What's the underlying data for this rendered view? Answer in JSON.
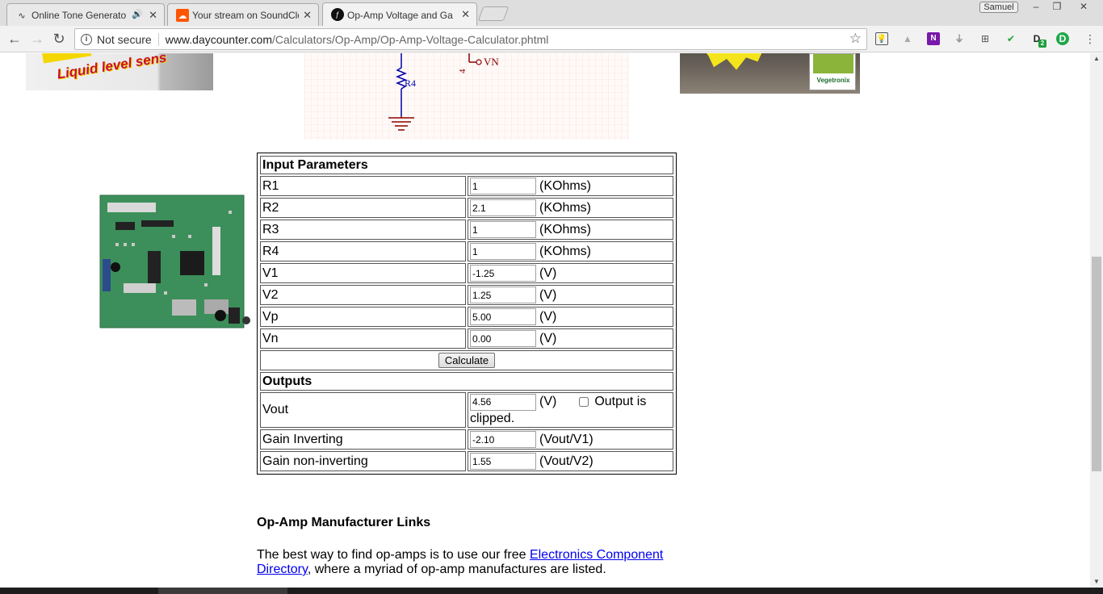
{
  "browser": {
    "tabs": [
      {
        "title": "Online Tone Generato",
        "audio": true,
        "favicon": "wave-icon",
        "active": false
      },
      {
        "title": "Your stream on SoundClo",
        "audio": false,
        "favicon": "soundcloud-icon",
        "active": false
      },
      {
        "title": "Op-Amp Voltage and Ga",
        "audio": false,
        "favicon": "daycounter-icon",
        "active": true
      }
    ],
    "profile_name": "Samuel",
    "security_label": "Not secure",
    "url_host": "www.daycounter.com",
    "url_path": "/Calculators/Op-Amp/Op-Amp-Voltage-Calculator.phtml",
    "extension_badge": "2"
  },
  "schematic": {
    "resistor_label": "R4",
    "node_label": "VN",
    "pin_label": "4"
  },
  "ads": {
    "left_text": "Liquid level sens",
    "right_logo": "Vegetronix"
  },
  "calculator": {
    "input_header": "Input Parameters",
    "inputs": [
      {
        "label": "R1",
        "value": "1",
        "unit": "(KOhms)"
      },
      {
        "label": "R2",
        "value": "2.1",
        "unit": "(KOhms)"
      },
      {
        "label": "R3",
        "value": "1",
        "unit": "(KOhms)"
      },
      {
        "label": "R4",
        "value": "1",
        "unit": "(KOhms)"
      },
      {
        "label": "V1",
        "value": "-1.25",
        "unit": "(V)"
      },
      {
        "label": "V2",
        "value": "1.25",
        "unit": "(V)"
      },
      {
        "label": "Vp",
        "value": "5.00",
        "unit": "(V)"
      },
      {
        "label": "Vn",
        "value": "0.00",
        "unit": "(V)"
      }
    ],
    "calculate_label": "Calculate",
    "output_header": "Outputs",
    "vout": {
      "label": "Vout",
      "value": "4.56",
      "unit": "(V)",
      "clipped_label": "Output is clipped.",
      "clipped": false
    },
    "gain_inverting": {
      "label": "Gain Inverting",
      "value": "-2.10",
      "unit": "(Vout/V1)"
    },
    "gain_noninverting": {
      "label": "Gain non-inverting",
      "value": "1.55",
      "unit": "(Vout/V2)"
    }
  },
  "links_section": {
    "title": "Op-Amp Manufacturer Links",
    "text_before": "The best way to find op-amps is to use our free ",
    "link_text": "Electronics Component Directory",
    "text_after": ", where a myriad of op-amp manufactures are listed."
  },
  "colors": {
    "link": "#0000ee",
    "schematic_wire": "#0000aa",
    "schematic_ground": "#8b0000"
  }
}
